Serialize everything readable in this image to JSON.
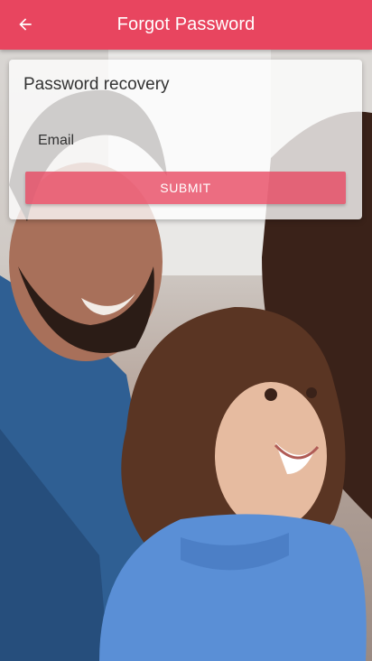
{
  "appbar": {
    "title": "Forgot Password",
    "back_icon": "arrow-left-icon",
    "color": "#e8455f"
  },
  "card": {
    "title": "Password recovery",
    "email_placeholder": "Email",
    "submit_label": "SUBMIT"
  },
  "background": {
    "image": "family-photo"
  }
}
